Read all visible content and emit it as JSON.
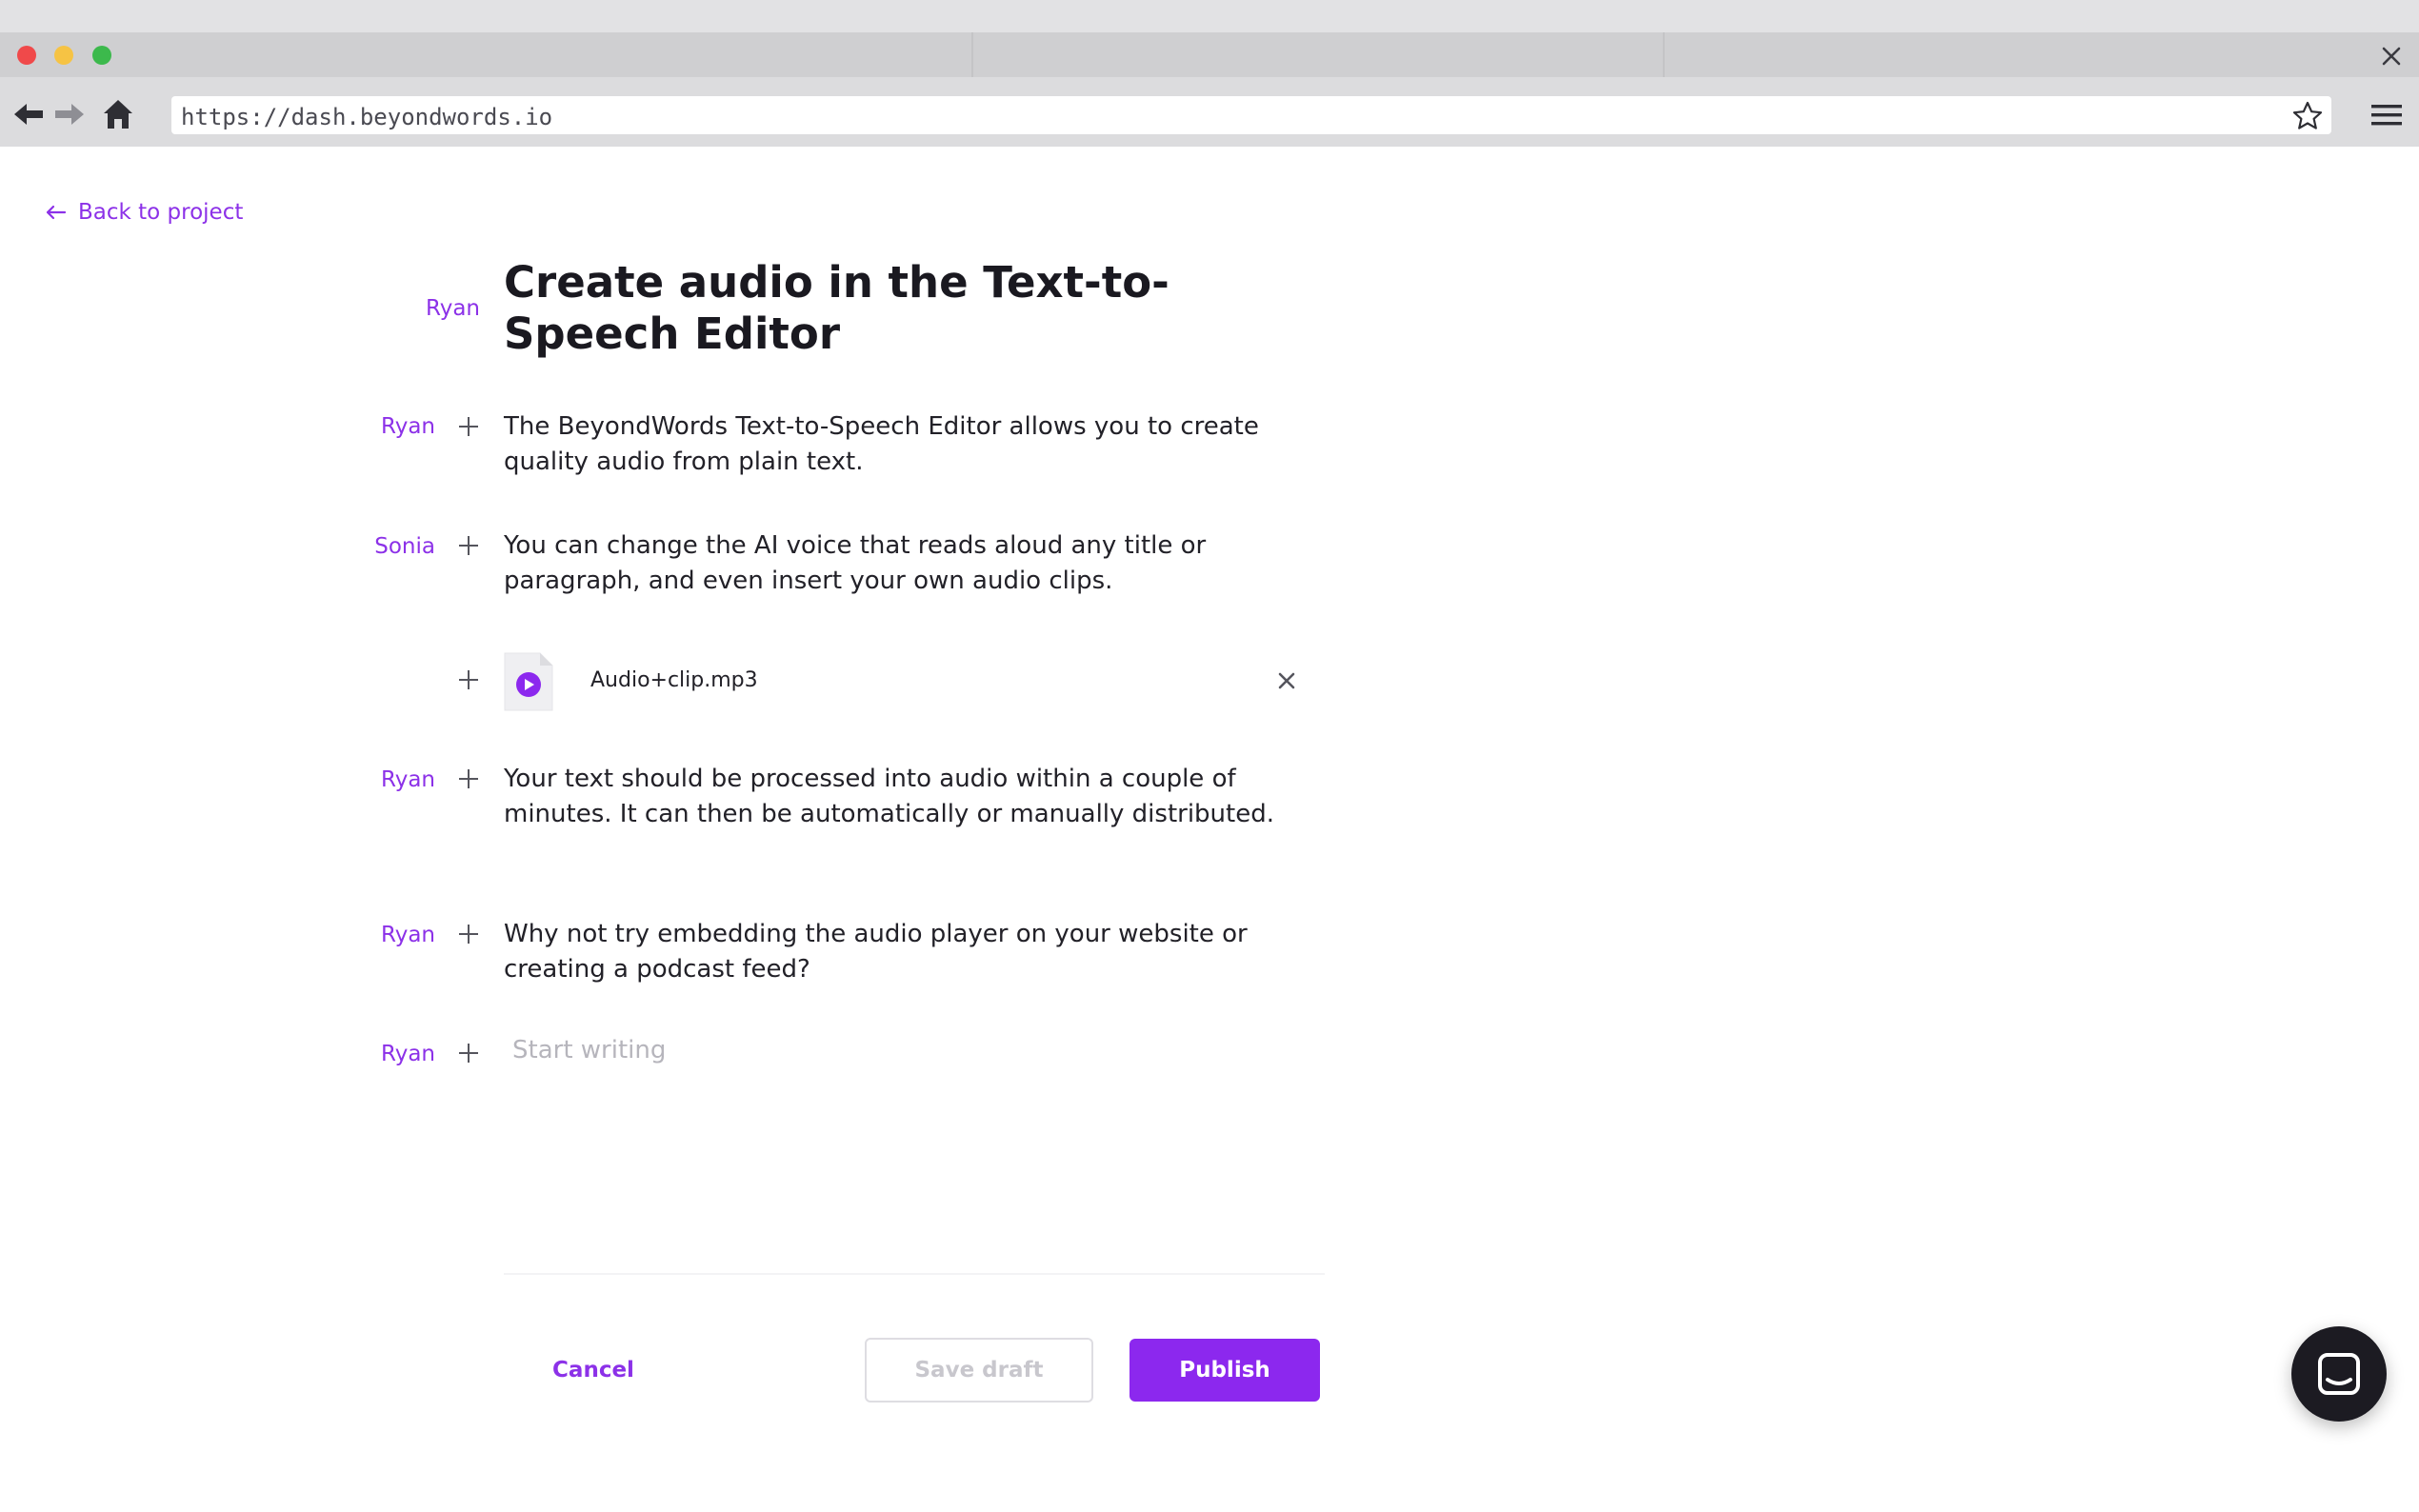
{
  "browser": {
    "url": "https://dash.beyondwords.io",
    "dots": [
      "#f0494a",
      "#f6c344",
      "#3cb94c"
    ]
  },
  "page": {
    "back_label": "Back to project",
    "title": {
      "speaker": "Ryan",
      "text": "Create audio in the Text-to-Speech Editor"
    },
    "paragraphs": [
      {
        "speaker": "Ryan",
        "text": "The BeyondWords Text-to-Speech Editor allows you to create quality audio from plain text."
      },
      {
        "speaker": "Sonia",
        "text": "You can change the AI voice that reads aloud any title or paragraph, and even insert your own audio clips."
      },
      {
        "speaker": "Ryan",
        "text": "Your text should be processed into audio within a couple of minutes. It can then be automatically or manually distributed."
      },
      {
        "speaker": "Ryan",
        "text": "Why not try embedding the audio player on your website or creating a podcast feed?"
      }
    ],
    "audio_clip": {
      "filename": "Audio+clip.mp3"
    },
    "new_block": {
      "speaker": "Ryan",
      "placeholder": "Start writing"
    }
  },
  "actions": {
    "cancel": "Cancel",
    "save_draft": "Save draft",
    "publish": "Publish"
  },
  "colors": {
    "accent": "#8c31e8",
    "publish_bg": "#8c28ee",
    "chat_bg": "#1c1b22"
  }
}
